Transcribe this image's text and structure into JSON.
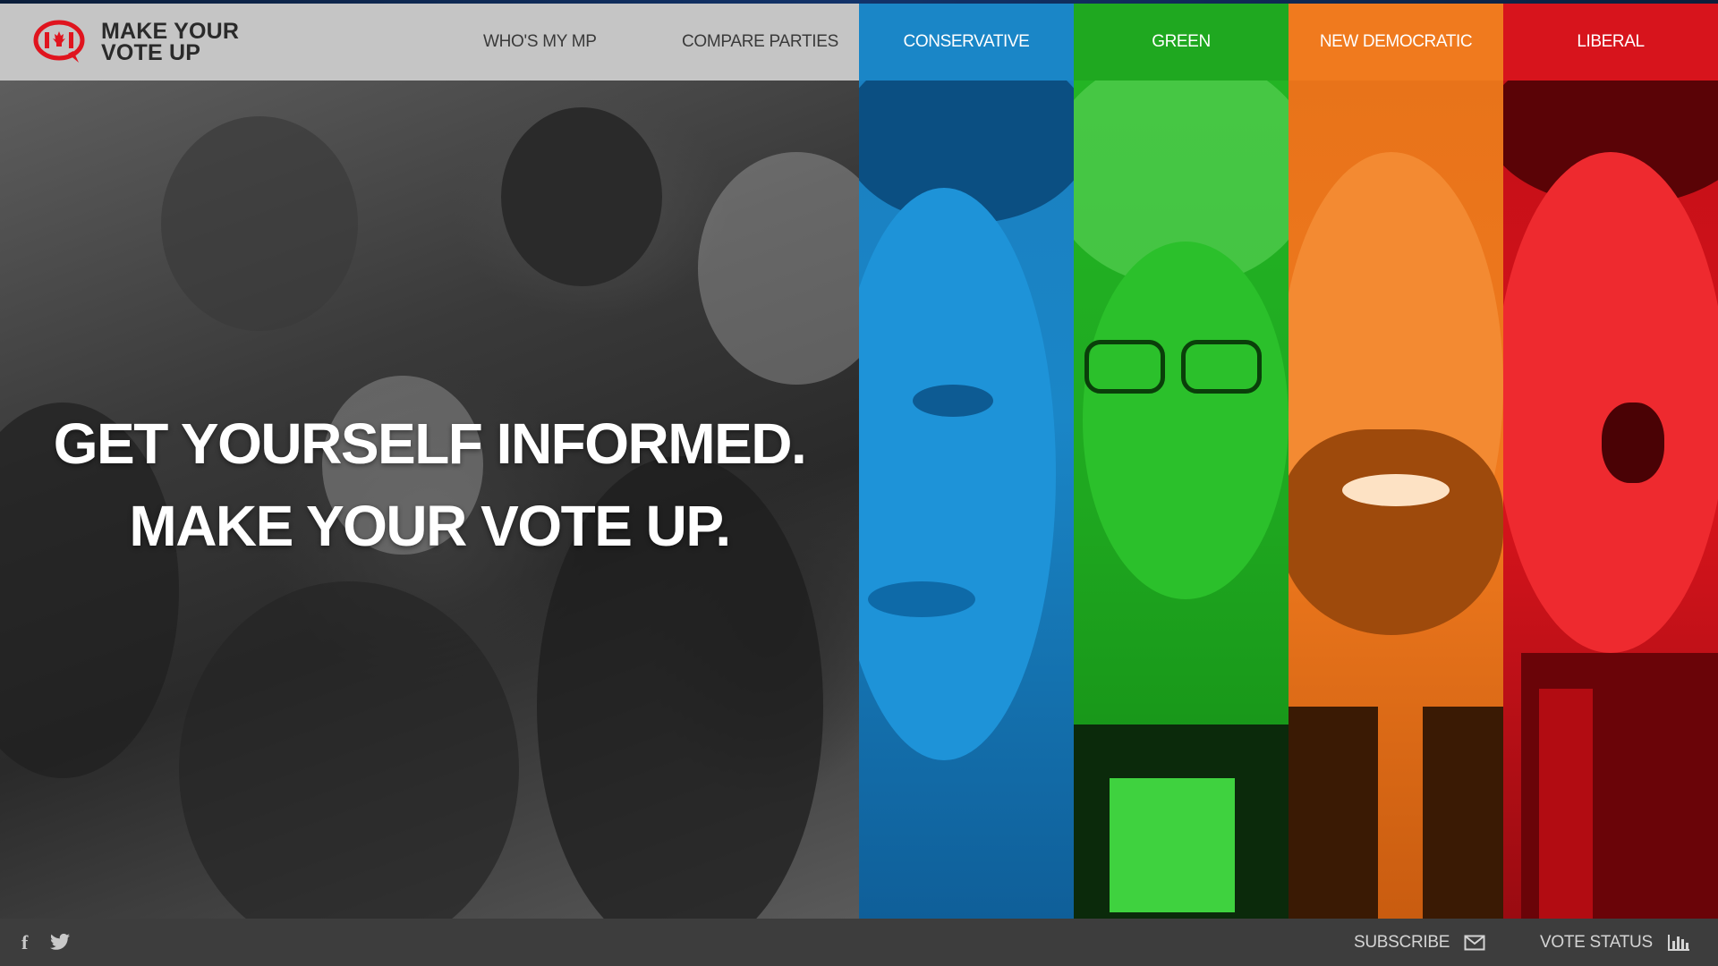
{
  "brand": {
    "line1": "MAKE YOUR",
    "line2": "VOTE UP",
    "color": "#e0141e"
  },
  "nav": {
    "whos_my_mp": "WHO'S MY MP",
    "compare_parties": "COMPARE PARTIES"
  },
  "parties": [
    {
      "label": "CONSERVATIVE",
      "color": "#1a86c7"
    },
    {
      "label": "GREEN",
      "color": "#1fa820"
    },
    {
      "label": "NEW DEMOCRATIC",
      "color": "#f07a1e"
    },
    {
      "label": "LIBERAL",
      "color": "#d7141c"
    }
  ],
  "hero": {
    "line1": "GET YOURSELF INFORMED.",
    "line2": "MAKE YOUR VOTE UP."
  },
  "footer": {
    "facebook_icon": "facebook-icon",
    "twitter_icon": "twitter-icon",
    "subscribe": "SUBSCRIBE",
    "vote_status": "VOTE STATUS"
  }
}
